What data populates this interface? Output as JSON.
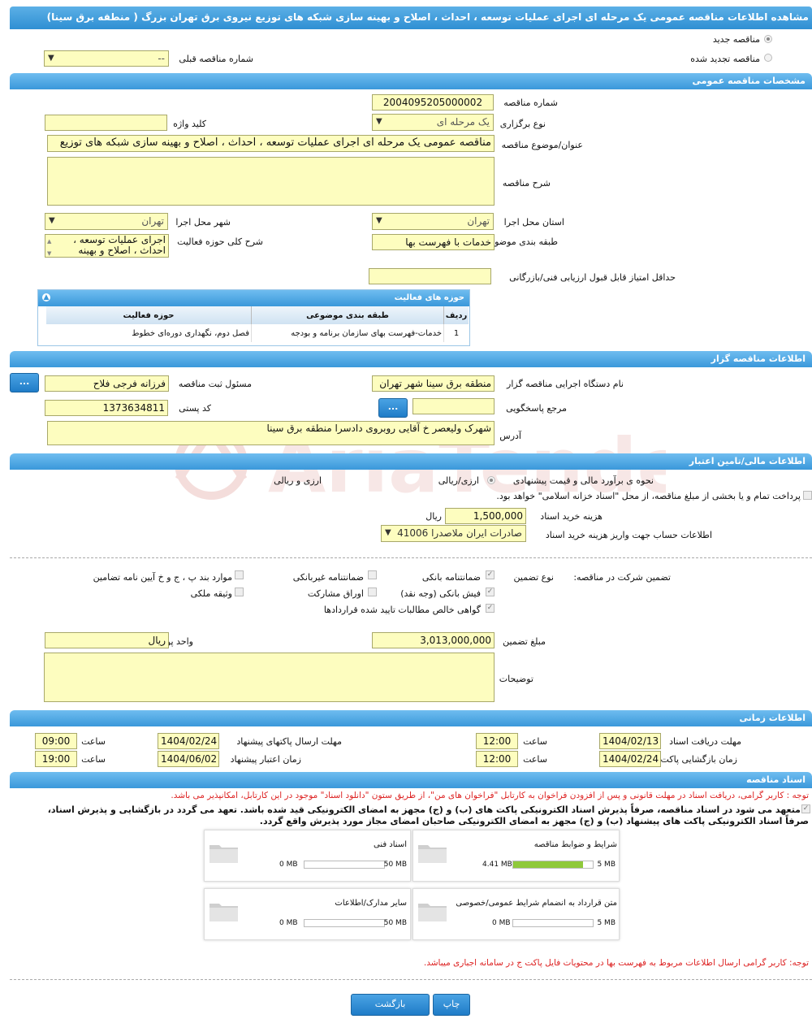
{
  "page_title": "مشاهده اطلاعات مناقصه عمومی یک مرحله ای اجرای عملیات توسعه ، احداث ، اصلاح و بهینه سازی شبکه های توزیع نیروی برق تهران بزرگ ( منطقه برق سینا)",
  "top": {
    "radio_new": "مناقصه جدید",
    "radio_renewed": "مناقصه تجدید شده",
    "previous_tender_label": "شماره مناقصه قبلی",
    "previous_tender_value": "--"
  },
  "general": {
    "section_title": "مشخصات مناقصه عمومی",
    "tender_number_label": "شماره مناقصه",
    "tender_number": "2004095205000002",
    "holding_type_label": "نوع برگزاری",
    "holding_type": "یک مرحله ای",
    "keyword_label": "کلید واژه",
    "keyword": "",
    "subject_label": "عنوان/موضوع مناقصه",
    "subject": "مناقصه عمومی یک مرحله ای اجرای عملیات توسعه ، احداث ، اصلاح و بهینه سازی شبکه های توزیع",
    "description_label": "شرح مناقصه",
    "description": "",
    "province_label": "استان محل اجرا",
    "province": "تهران",
    "city_label": "شهر محل اجرا",
    "city": "تهران",
    "category_label": "طبقه بندی موضوعی",
    "category": "خدمات با فهرست بها",
    "activity_desc_label": "شرح کلی حوزه فعالیت",
    "activity_desc": "اجرای عملیات توسعه ، احداث ، اصلاح و بهینه",
    "min_score_label": "حداقل امتیاز قابل قبول ارزیابی فنی/بازرگانی",
    "min_score": ""
  },
  "activity_table": {
    "title": "حوزه های فعالیت",
    "headers": [
      "ردیف",
      "طبقه بندی موضوعی",
      "حوزه فعالیت"
    ],
    "rows": [
      [
        "1",
        "خدمات-فهرست بهای سازمان برنامه و بودجه",
        "فصل دوم، نگهداری دوره‌ای خطوط"
      ]
    ]
  },
  "organizer": {
    "section_title": "اطلاعات مناقصه گزار",
    "org_label": "نام دستگاه اجرایی مناقصه گزار",
    "org": "منطقه برق سینا شهر تهران",
    "registrar_label": "مسئول ثبت مناقصه",
    "registrar": "فرزانه فرجی فلاح",
    "registrar_button": "...",
    "responder_label": "مرجع پاسخگویی",
    "responder": "",
    "responder_button": "...",
    "postal_label": "کد پستی",
    "postal": "1373634811",
    "address_label": "آدرس",
    "address": "شهرک ولیعصر خ آقایی روبروی دادسرا منطقه برق سینا"
  },
  "finance": {
    "section_title": "اطلاعات مالی/تامین اعتبار",
    "estimate_label": "نحوه ی برآورد مالی و قیمت پیشنهادی",
    "opt_currency": "ارزی/ریالی",
    "opt_currency_rial": "ارزی و ریالی",
    "payment_note": "پرداخت تمام و یا بخشی از مبلغ مناقصه، از محل \"اسناد خزانه اسلامی\" خواهد بود.",
    "doc_fee_label": "هزینه خرید اسناد",
    "doc_fee": "1,500,000",
    "doc_fee_unit": "ریال",
    "account_label": "اطلاعات حساب جهت واریز هزینه خرید اسناد",
    "account": "صادرات ایران ملاصدرا 41006"
  },
  "guarantee": {
    "title_label": "تضمین شرکت در مناقصه:",
    "type_label": "نوع تضمین",
    "options": {
      "bank_guarantee": "ضمانتنامه بانکی",
      "non_bank_guarantee": "ضمانتنامه غیربانکی",
      "regulation_items": "موارد بند پ ، ج و خ آیین نامه تضامین",
      "bank_receipt": "فیش بانکی (وجه نقد)",
      "participation_bonds": "اوراق مشارکت",
      "property_collateral": "وثیقه ملکی",
      "net_claims_cert": "گواهی خالص مطالبات تایید شده قراردادها"
    },
    "amount_label": "مبلغ تضمین",
    "amount": "3,013,000,000",
    "currency_label": "واحد پول",
    "currency": "ریال",
    "notes_label": "توضیحات",
    "notes": ""
  },
  "timing": {
    "section_title": "اطلاعات زمانی",
    "doc_receive_deadline_label": "مهلت دریافت اسناد",
    "doc_receive_date": "1404/02/13",
    "doc_receive_time": "12:00",
    "send_deadline_label": "مهلت ارسال پاکتهای پیشنهاد",
    "send_date": "1404/02/24",
    "send_time": "09:00",
    "opening_label": "زمان بازگشایی پاکت ها",
    "opening_date": "1404/02/24",
    "opening_time": "12:00",
    "validity_label": "زمان اعتبار پیشنهاد",
    "validity_date": "1404/06/02",
    "validity_time": "19:00",
    "time_label": "ساعت"
  },
  "documents": {
    "section_title": "اسناد مناقصه",
    "note1": "توجه : کاربر گرامی، دریافت اسناد در مهلت قانونی و پس از افزودن فراخوان به کارتابل \"فراخوان های من\"، از طریق ستون \"دانلود اسناد\" موجود در این کارتابل، امکانپذیر می باشد.",
    "commit_line1": "متعهد می شود در اسناد مناقصه، صرفاً پذیرش اسناد الکترونیکی پاکت های (ب) و (ج) مجهز به امضای الکترونیکی قید شده باشد. تعهد می گردد در بازگشایی و پذیرش اسناد،",
    "commit_line2": "صرفاً اسناد الکترونیکی پاکت های پیشنهاد (ب) و (ج) مجهز به امضای الکترونیکی صاحبان امضای مجاز مورد پذیرش واقع گردد.",
    "cards": [
      {
        "name": "شرایط و ضوابط مناقصه",
        "used": "4.41 MB",
        "max": "5 MB",
        "progress": 0.88
      },
      {
        "name": "اسناد فنی",
        "used": "0 MB",
        "max": "50 MB",
        "progress": 0
      },
      {
        "name": "متن قرارداد به انضمام شرایط عمومی/خصوصی",
        "used": "0 MB",
        "max": "5 MB",
        "progress": 0
      },
      {
        "name": "سایر مدارک/اطلاعات",
        "used": "0 MB",
        "max": "50 MB",
        "progress": 0
      }
    ],
    "note2": "توجه: کاربر گرامی ارسال اطلاعات مربوط به فهرست بها در محتویات فایل پاکت ج در سامانه اجباری میباشد."
  },
  "buttons": {
    "print": "چاپ",
    "back": "بازگشت"
  },
  "colors": {
    "header_blue": "#2f8fd3",
    "field_yellow": "#fdfdbf",
    "progress_green": "#8fc93a",
    "note_red": "#d22222"
  }
}
